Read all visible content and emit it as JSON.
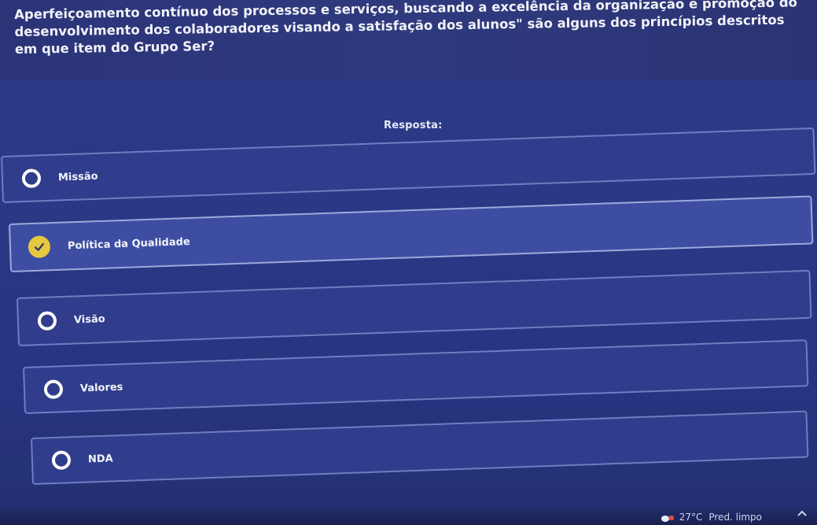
{
  "question": {
    "text": "Aperfeiçoamento contínuo dos processos e serviços, buscando a excelência da organização e promoção do desenvolvimento dos colaboradores visando a satisfação dos alunos\" são alguns dos princípios descritos em que item do Grupo Ser?"
  },
  "answer_label": "Resposta:",
  "options": [
    {
      "label": "Missão",
      "selected": false
    },
    {
      "label": "Política da Qualidade",
      "selected": true
    },
    {
      "label": "Visão",
      "selected": false
    },
    {
      "label": "Valores",
      "selected": false
    },
    {
      "label": "NDA",
      "selected": false
    }
  ],
  "taskbar": {
    "temperature": "27°C",
    "weather": "Pred. limpo"
  },
  "colors": {
    "accent_selected": "#e6c93e",
    "background": "#2a3885"
  }
}
